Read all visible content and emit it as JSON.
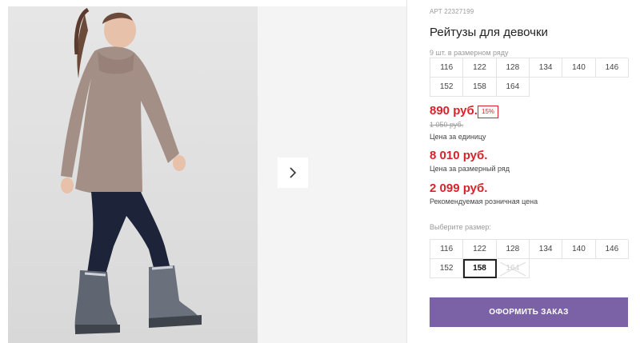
{
  "product": {
    "article": "АРТ 22327199",
    "title": "Рейтузы для девочки"
  },
  "size_row": {
    "caption": "9 шт. в размерном ряду",
    "sizes": [
      "116",
      "122",
      "128",
      "134",
      "140",
      "146",
      "152",
      "158",
      "164"
    ]
  },
  "pricing": {
    "unit_price": "890 руб.",
    "discount": "15%",
    "old_price": "1 050 руб.",
    "unit_label": "Цена за единицу",
    "row_price": "8 010 руб.",
    "row_label": "Цена за размерный ряд",
    "retail_price": "2 099 руб.",
    "retail_label": "Рекомендуемая розничная цена",
    "accent_color": "#d8232a"
  },
  "size_picker": {
    "caption": "Выберите размер:",
    "sizes": [
      {
        "label": "116",
        "state": "available"
      },
      {
        "label": "122",
        "state": "available"
      },
      {
        "label": "128",
        "state": "available"
      },
      {
        "label": "134",
        "state": "available"
      },
      {
        "label": "140",
        "state": "available"
      },
      {
        "label": "146",
        "state": "available"
      },
      {
        "label": "152",
        "state": "available"
      },
      {
        "label": "158",
        "state": "selected"
      },
      {
        "label": "164",
        "state": "unavailable"
      }
    ]
  },
  "gallery": {
    "next_icon": "chevron-right-icon"
  },
  "order_button": {
    "label": "ОФОРМИТЬ ЗАКАЗ",
    "color": "#7b62a6"
  }
}
